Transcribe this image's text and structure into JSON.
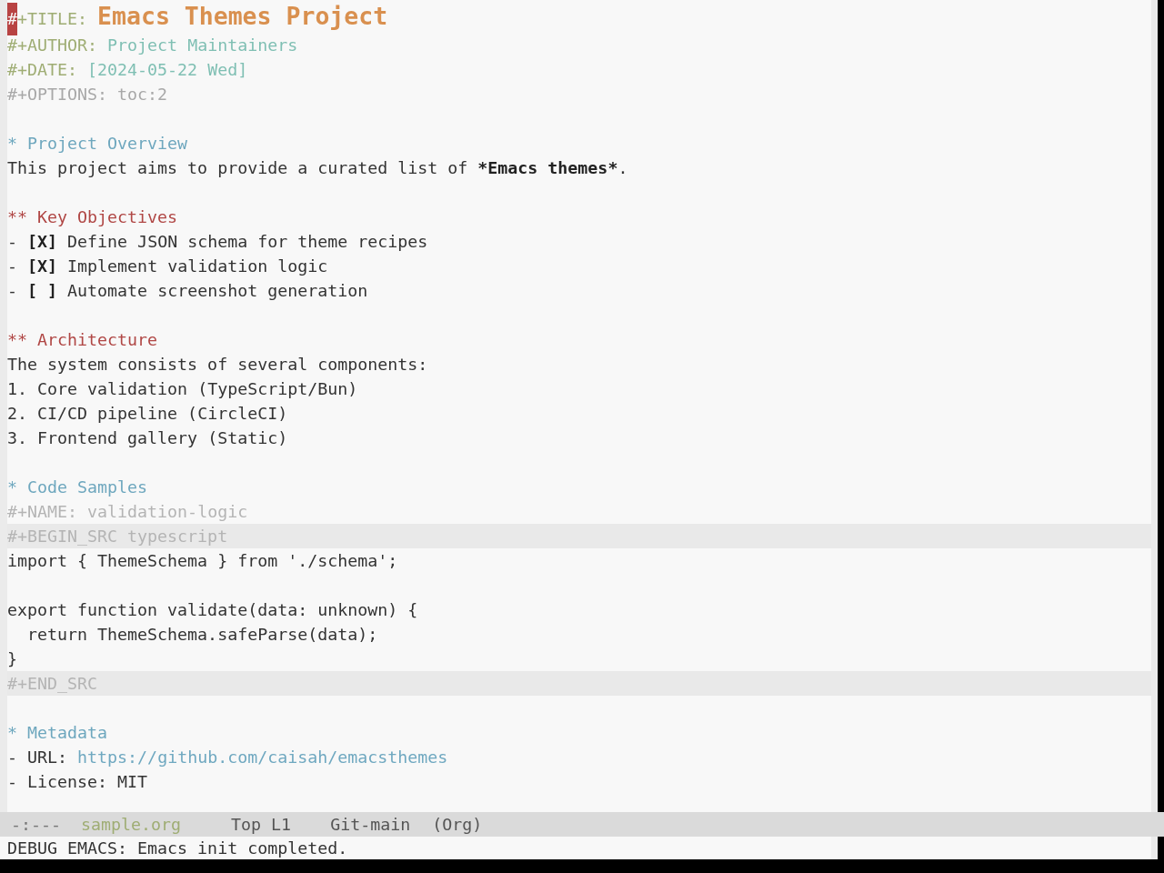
{
  "buffer": {
    "keywords": [
      {
        "kind": "title",
        "cursor": "#",
        "keyword": "+TITLE:",
        "value": "Emacs Themes Project"
      },
      {
        "kind": "author",
        "keyword": "#+AUTHOR:",
        "value": "Project Maintainers"
      },
      {
        "kind": "date",
        "keyword": "#+DATE:",
        "value": "[2024-05-22 Wed]"
      },
      {
        "kind": "options",
        "keyword": "#+OPTIONS:",
        "value": "toc:2"
      }
    ],
    "sections": [
      {
        "stars": "*",
        "title": "Project Overview",
        "body": [
          {
            "kind": "paragraph",
            "segments": [
              {
                "text": "This project aims to provide a curated list of ",
                "bold": false
              },
              {
                "text": "*Emacs themes*",
                "bold": true
              },
              {
                "text": ".",
                "bold": false
              }
            ]
          }
        ],
        "children": [
          {
            "stars": "**",
            "title": "Key Objectives",
            "body": [
              {
                "kind": "checkbox_item",
                "bullet": "-",
                "box": "[X]",
                "text": "Define JSON schema for theme recipes"
              },
              {
                "kind": "checkbox_item",
                "bullet": "-",
                "box": "[X]",
                "text": "Implement validation logic"
              },
              {
                "kind": "checkbox_item",
                "bullet": "-",
                "box": "[ ]",
                "text": "Automate screenshot generation"
              }
            ]
          },
          {
            "stars": "**",
            "title": "Architecture",
            "body": [
              {
                "kind": "paragraph",
                "segments": [
                  {
                    "text": "The system consists of several components:",
                    "bold": false
                  }
                ]
              },
              {
                "kind": "numbered_item",
                "number": "1.",
                "text": "Core validation (TypeScript/Bun)"
              },
              {
                "kind": "numbered_item",
                "number": "2.",
                "text": "CI/CD pipeline (CircleCI)"
              },
              {
                "kind": "numbered_item",
                "number": "3.",
                "text": "Frontend gallery (Static)"
              }
            ]
          }
        ]
      },
      {
        "stars": "*",
        "title": "Code Samples",
        "body": [
          {
            "kind": "keyword",
            "keyword": "#+NAME:",
            "value": "validation-logic"
          },
          {
            "kind": "src_block",
            "begin": "#+BEGIN_SRC typescript",
            "code": "import { ThemeSchema } from './schema';\n\nexport function validate(data: unknown) {\n  return ThemeSchema.safeParse(data);\n}",
            "end": "#+END_SRC"
          }
        ]
      },
      {
        "stars": "*",
        "title": "Metadata",
        "body": [
          {
            "kind": "link_item",
            "bullet": "-",
            "label": "URL:",
            "url": "https://github.com/caisah/emacsthemes"
          },
          {
            "kind": "text_item",
            "bullet": "-",
            "text": "License: MIT"
          }
        ]
      }
    ]
  },
  "mode_line": {
    "status": "-:---",
    "buffer_name": "sample.org",
    "position": "Top L1",
    "branch": "Git-main",
    "major_mode": "(Org)"
  },
  "echo_area": "DEBUG EMACS: Emacs init completed."
}
